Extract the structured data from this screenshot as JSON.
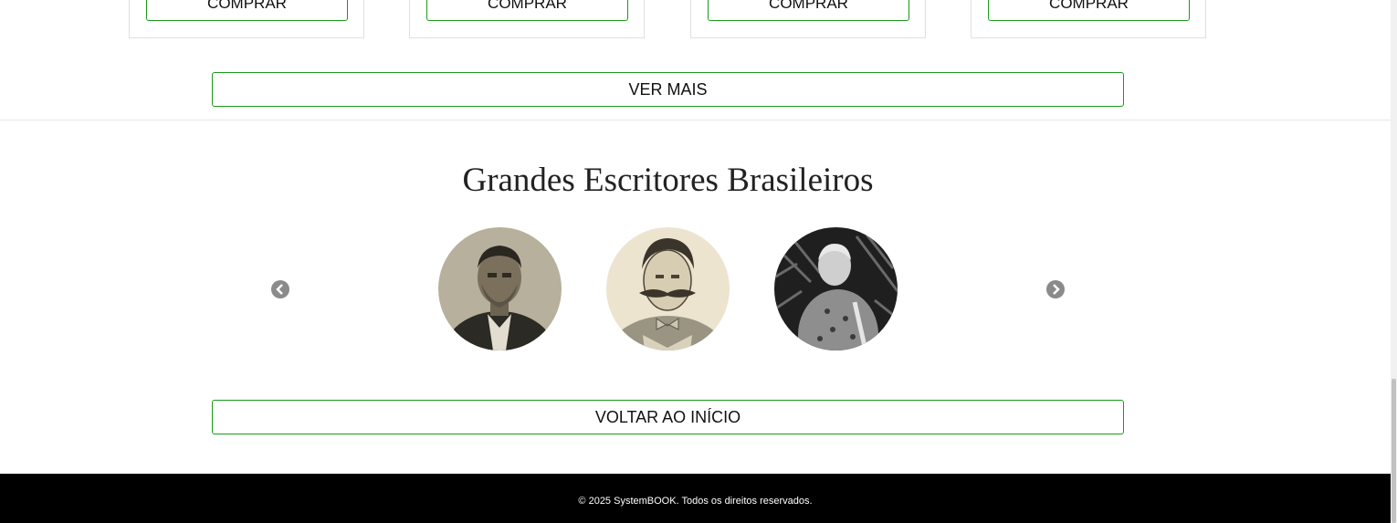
{
  "products": {
    "cards": [
      {
        "button_label": "COMPRAR"
      },
      {
        "button_label": "COMPRAR"
      },
      {
        "button_label": "COMPRAR"
      },
      {
        "button_label": "COMPRAR"
      }
    ],
    "see_more_label": "VER MAIS"
  },
  "writers": {
    "title": "Grandes Escritores Brasileiros",
    "prev_icon": "chevron-left-circle-icon",
    "next_icon": "chevron-right-circle-icon",
    "back_to_top_label": "VOLTAR AO INÍCIO"
  },
  "footer": {
    "copyright": "© 2025 SystemBOOK. Todos os direitos reservados."
  },
  "colors": {
    "accent_border": "#1a9a1a",
    "footer_bg": "#000000",
    "footer_text": "#ffffff"
  }
}
